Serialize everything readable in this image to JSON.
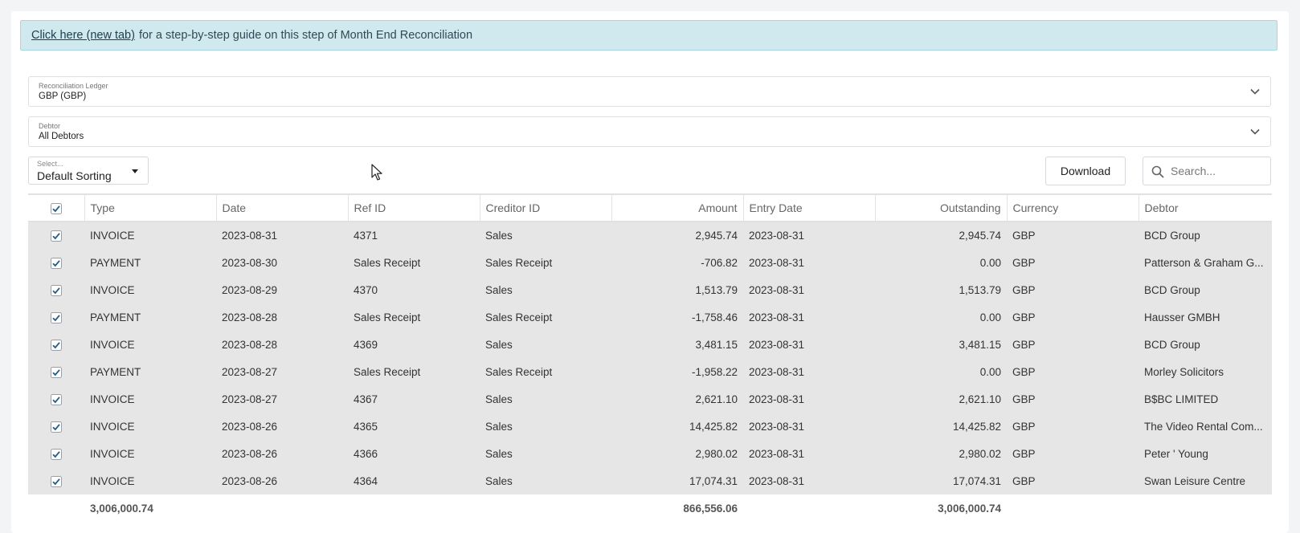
{
  "banner": {
    "link_text": "Click here (new tab)",
    "rest_text": "for a step-by-step guide on this step of Month End Reconciliation"
  },
  "ledger_select": {
    "label": "Reconciliation Ledger",
    "value": "GBP (GBP)"
  },
  "debtor_select": {
    "label": "Debtor",
    "value": "All Debtors"
  },
  "sorting": {
    "label": "Select...",
    "value": "Default Sorting"
  },
  "download_label": "Download",
  "search": {
    "placeholder": "Search..."
  },
  "table": {
    "headers": [
      "Type",
      "Date",
      "Ref ID",
      "Creditor ID",
      "Amount",
      "Entry Date",
      "Outstanding",
      "Currency",
      "Debtor"
    ],
    "rows": [
      {
        "type": "INVOICE",
        "date": "2023-08-31",
        "ref": "4371",
        "creditor": "Sales",
        "amount": "2,945.74",
        "entry": "2023-08-31",
        "outstanding": "2,945.74",
        "currency": "GBP",
        "debtor": "BCD Group"
      },
      {
        "type": "PAYMENT",
        "date": "2023-08-30",
        "ref": "Sales Receipt",
        "creditor": "Sales Receipt",
        "amount": "-706.82",
        "entry": "2023-08-31",
        "outstanding": "0.00",
        "currency": "GBP",
        "debtor": "Patterson & Graham G..."
      },
      {
        "type": "INVOICE",
        "date": "2023-08-29",
        "ref": "4370",
        "creditor": "Sales",
        "amount": "1,513.79",
        "entry": "2023-08-31",
        "outstanding": "1,513.79",
        "currency": "GBP",
        "debtor": "BCD Group"
      },
      {
        "type": "PAYMENT",
        "date": "2023-08-28",
        "ref": "Sales Receipt",
        "creditor": "Sales Receipt",
        "amount": "-1,758.46",
        "entry": "2023-08-31",
        "outstanding": "0.00",
        "currency": "GBP",
        "debtor": "Hausser GMBH"
      },
      {
        "type": "INVOICE",
        "date": "2023-08-28",
        "ref": "4369",
        "creditor": "Sales",
        "amount": "3,481.15",
        "entry": "2023-08-31",
        "outstanding": "3,481.15",
        "currency": "GBP",
        "debtor": "BCD Group"
      },
      {
        "type": "PAYMENT",
        "date": "2023-08-27",
        "ref": "Sales Receipt",
        "creditor": "Sales Receipt",
        "amount": "-1,958.22",
        "entry": "2023-08-31",
        "outstanding": "0.00",
        "currency": "GBP",
        "debtor": "Morley Solicitors"
      },
      {
        "type": "INVOICE",
        "date": "2023-08-27",
        "ref": "4367",
        "creditor": "Sales",
        "amount": "2,621.10",
        "entry": "2023-08-31",
        "outstanding": "2,621.10",
        "currency": "GBP",
        "debtor": "B$BC LIMITED"
      },
      {
        "type": "INVOICE",
        "date": "2023-08-26",
        "ref": "4365",
        "creditor": "Sales",
        "amount": "14,425.82",
        "entry": "2023-08-31",
        "outstanding": "14,425.82",
        "currency": "GBP",
        "debtor": "The Video Rental Com..."
      },
      {
        "type": "INVOICE",
        "date": "2023-08-26",
        "ref": "4366",
        "creditor": "Sales",
        "amount": "2,980.02",
        "entry": "2023-08-31",
        "outstanding": "2,980.02",
        "currency": "GBP",
        "debtor": "Peter ' Young"
      },
      {
        "type": "INVOICE",
        "date": "2023-08-26",
        "ref": "4364",
        "creditor": "Sales",
        "amount": "17,074.31",
        "entry": "2023-08-31",
        "outstanding": "17,074.31",
        "currency": "GBP",
        "debtor": "Swan Leisure Centre"
      }
    ],
    "totals": {
      "type_col": "3,006,000.74",
      "amount_col": "866,556.06",
      "outstanding_col": "3,006,000.74"
    }
  },
  "colors": {
    "banner_bg": "#cfe9ef",
    "row_bg": "#e6e6e6",
    "checkbox": "#1f5f8b"
  },
  "icons": {
    "select_chevron": "chevron-down-icon",
    "sort_caret": "caret-down-icon",
    "search": "search-icon",
    "checkbox": "checkbox-checked-icon",
    "cursor": "mouse-pointer-icon"
  }
}
